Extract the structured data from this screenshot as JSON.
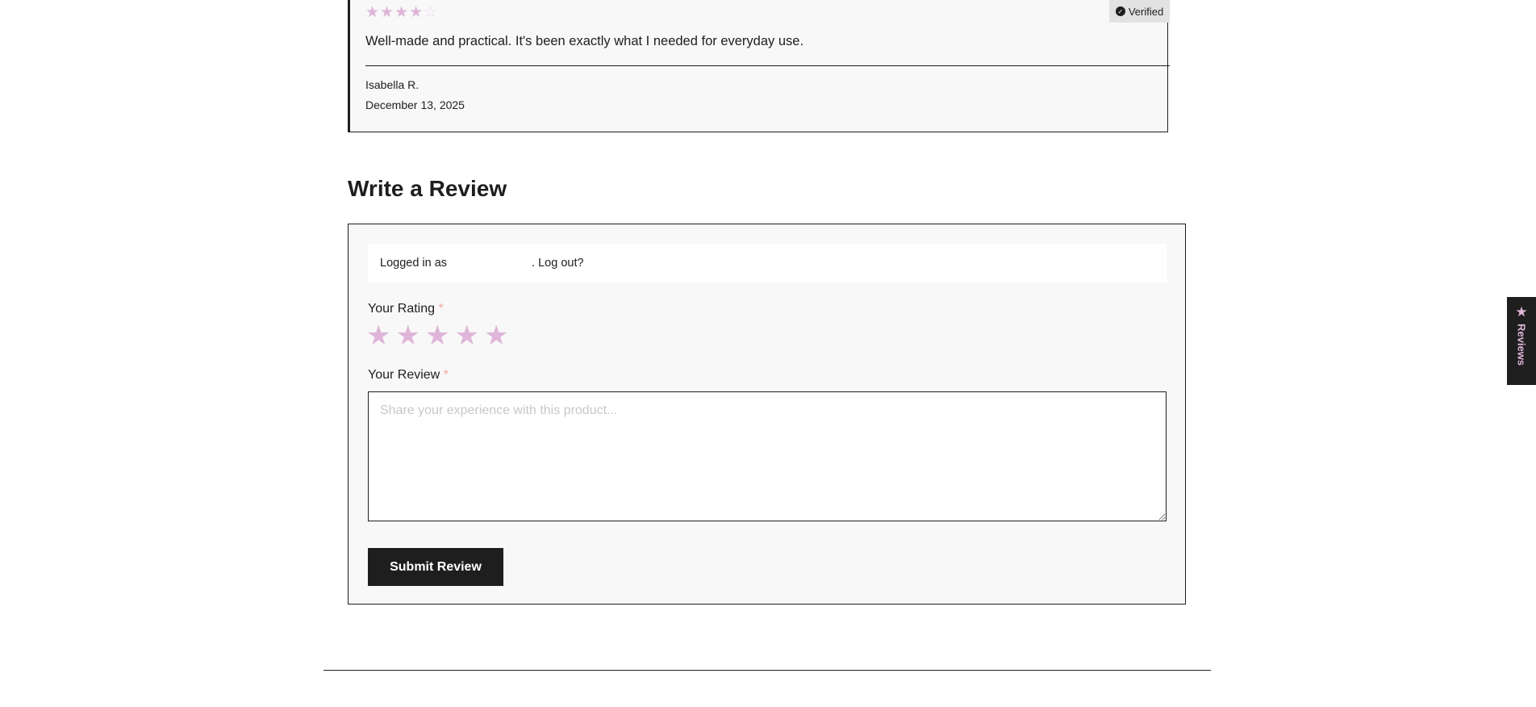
{
  "review": {
    "rating": 4,
    "max_rating": 5,
    "stars_filled": "★★★★",
    "stars_empty": "☆",
    "verified_label": "Verified",
    "text": "Well-made and practical. It's been exactly what I needed for everyday use.",
    "author": "Isabella R.",
    "date": "December 13, 2025"
  },
  "write_review": {
    "heading": "Write a Review",
    "logged_in_prefix": "Logged in as",
    "logout_link": ". Log out?",
    "rating_label": "Your Rating",
    "required_mark": "*",
    "rating_stars": [
      "★",
      "★",
      "★",
      "★",
      "★"
    ],
    "review_label": "Your Review",
    "review_placeholder": "Share your experience with this product...",
    "submit_label": "Submit Review"
  },
  "side_tab": {
    "label": "Reviews",
    "icon": "★"
  },
  "colors": {
    "accent": "#dfb6d9",
    "dark": "#1e1e1e",
    "required": "#f0a6a6"
  }
}
